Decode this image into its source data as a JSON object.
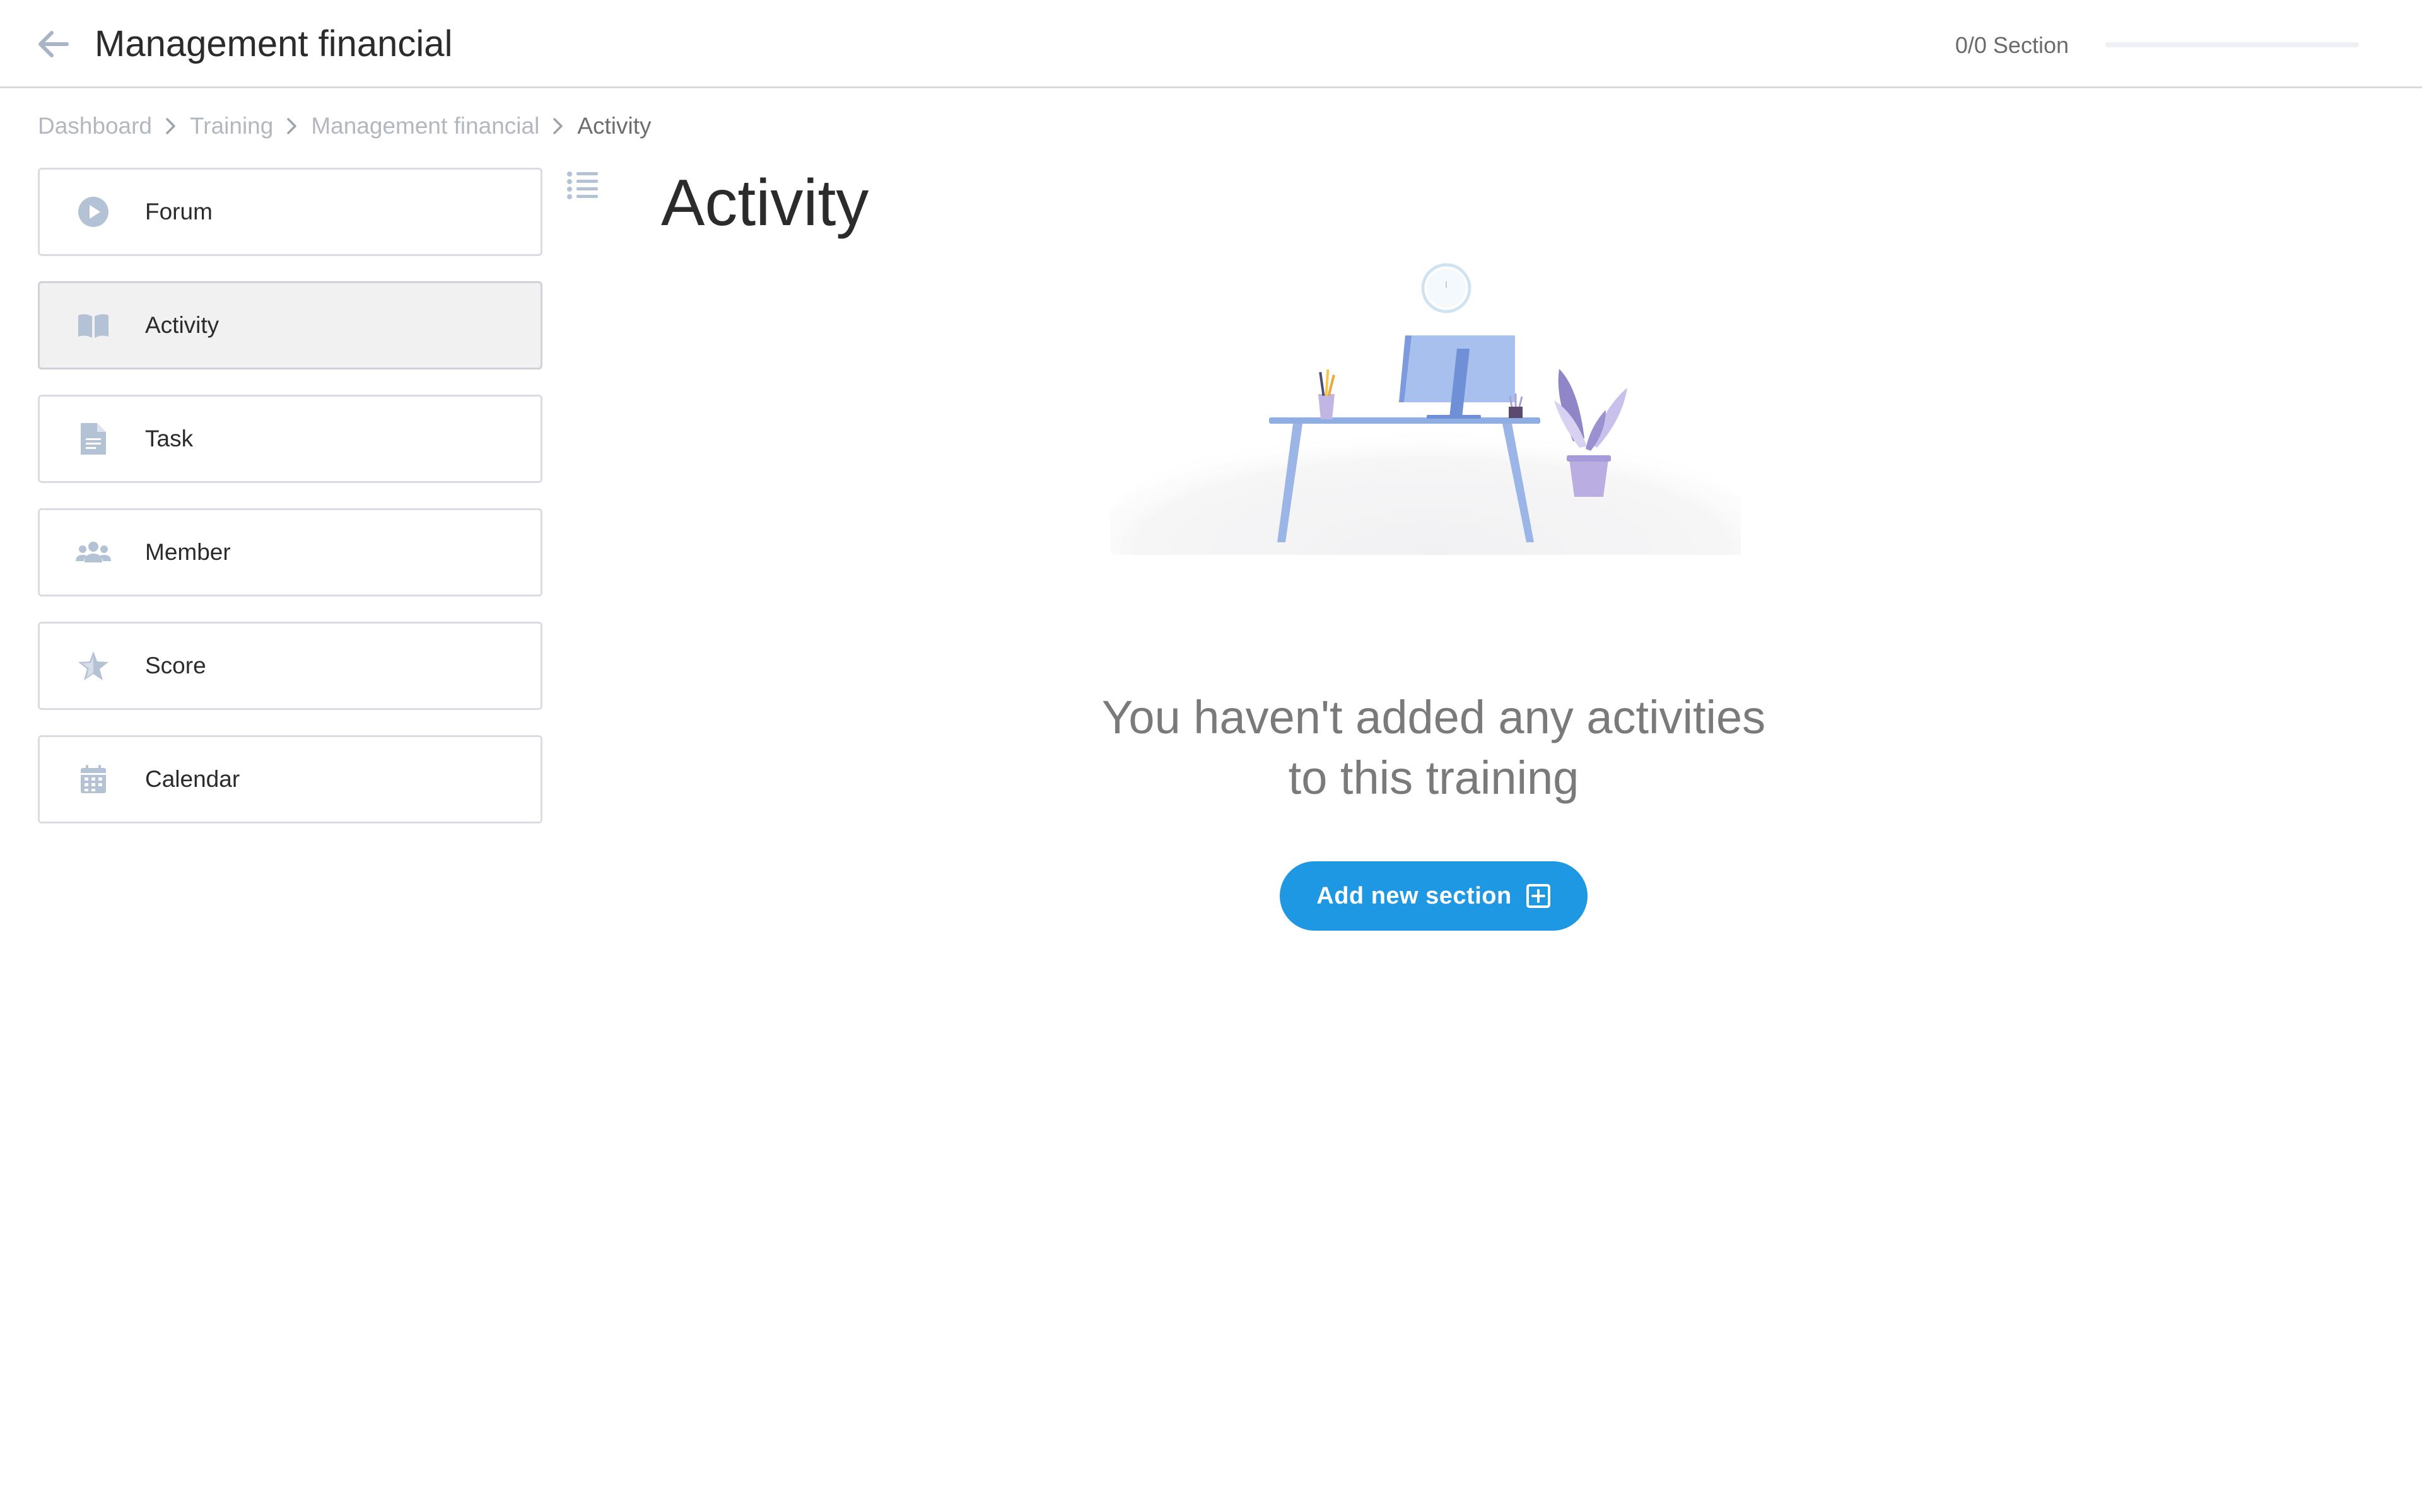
{
  "header": {
    "title": "Management financial",
    "section_count": "0/0 Section",
    "progress_fraction": 0
  },
  "breadcrumb": [
    {
      "label": "Dashboard"
    },
    {
      "label": "Training"
    },
    {
      "label": "Management financial"
    },
    {
      "label": "Activity"
    }
  ],
  "sidebar": {
    "items": [
      {
        "label": "Forum",
        "icon": "play-circle-icon"
      },
      {
        "label": "Activity",
        "icon": "book-icon",
        "active": true
      },
      {
        "label": "Task",
        "icon": "document-icon"
      },
      {
        "label": "Member",
        "icon": "users-icon"
      },
      {
        "label": "Score",
        "icon": "star-icon"
      },
      {
        "label": "Calendar",
        "icon": "calendar-icon"
      }
    ]
  },
  "main": {
    "title": "Activity",
    "empty_message_line1": "You haven't added any activities",
    "empty_message_line2": "to this training",
    "add_button_label": "Add new section"
  },
  "colors": {
    "accent": "#1f98e3",
    "icon": "#b4c2d6",
    "active_bg": "#f1f1f2",
    "text_dark": "#2b2b2b",
    "text_muted": "#7a7a7a"
  }
}
